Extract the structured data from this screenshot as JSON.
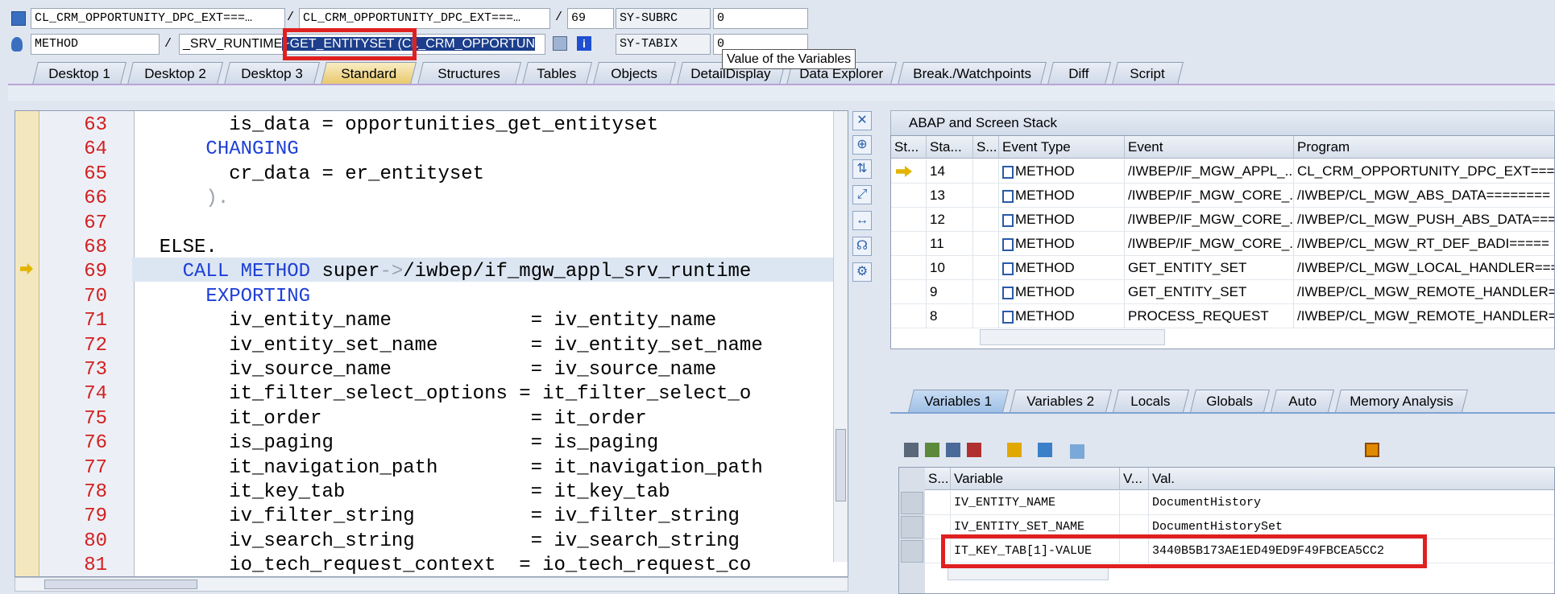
{
  "header": {
    "program_field": "CL_CRM_OPPORTUNITY_DPC_EXT===…",
    "include_field": "CL_CRM_OPPORTUNITY_DPC_EXT===…",
    "line_field": "69",
    "sy_subrc_label": "SY-SUBRC",
    "sy_subrc_value": "0",
    "event_type_field": "METHOD",
    "event_prefix": "_SRV_RUNTIME",
    "event_highlight": "~GET_ENTITYSET (CL_CRM_OPPORTUN",
    "sy_tabix_label": "SY-TABIX",
    "sy_tabix_value": "0",
    "slash1": "/",
    "slash2": "/",
    "slash3": "/",
    "tooltip": "Value of the Variables"
  },
  "tabs": [
    "Desktop 1",
    "Desktop 2",
    "Desktop 3",
    "Standard",
    "Structures",
    "Tables",
    "Objects",
    "DetailDisplay",
    "Data Explorer",
    "Break./Watchpoints",
    "Diff",
    "Script"
  ],
  "code": [
    {
      "n": "63",
      "parts": [
        [
          "",
          "        is_data = opportunities_get_entityset"
        ]
      ]
    },
    {
      "n": "64",
      "parts": [
        [
          "kw",
          "      CHANGING"
        ]
      ]
    },
    {
      "n": "65",
      "parts": [
        [
          "",
          "        cr_data = er_entityset"
        ]
      ]
    },
    {
      "n": "66",
      "parts": [
        [
          "gray",
          "      )."
        ]
      ]
    },
    {
      "n": "67",
      "parts": [
        [
          "",
          ""
        ]
      ]
    },
    {
      "n": "68",
      "parts": [
        [
          "",
          "  ELSE."
        ]
      ]
    },
    {
      "n": "69",
      "parts": [
        [
          "kw",
          "    CALL METHOD "
        ],
        [
          "",
          "super"
        ],
        [
          "gray",
          "->"
        ],
        [
          "",
          "/iwbep/if_mgw_appl_srv_runtime"
        ]
      ]
    },
    {
      "n": "70",
      "parts": [
        [
          "kw",
          "      EXPORTING"
        ]
      ]
    },
    {
      "n": "71",
      "parts": [
        [
          "",
          "        iv_entity_name            = iv_entity_name"
        ]
      ]
    },
    {
      "n": "72",
      "parts": [
        [
          "",
          "        iv_entity_set_name        = iv_entity_set_name"
        ]
      ]
    },
    {
      "n": "73",
      "parts": [
        [
          "",
          "        iv_source_name            = iv_source_name"
        ]
      ]
    },
    {
      "n": "74",
      "parts": [
        [
          "",
          "        it_filter_select_options = it_filter_select_o"
        ]
      ]
    },
    {
      "n": "75",
      "parts": [
        [
          "",
          "        it_order                  = it_order"
        ]
      ]
    },
    {
      "n": "76",
      "parts": [
        [
          "",
          "        is_paging                 = is_paging"
        ]
      ]
    },
    {
      "n": "77",
      "parts": [
        [
          "",
          "        it_navigation_path        = it_navigation_path"
        ]
      ]
    },
    {
      "n": "78",
      "parts": [
        [
          "",
          "        it_key_tab                = it_key_tab"
        ]
      ]
    },
    {
      "n": "79",
      "parts": [
        [
          "",
          "        iv_filter_string          = iv_filter_string"
        ]
      ]
    },
    {
      "n": "80",
      "parts": [
        [
          "",
          "        iv_search_string          = iv_search_string"
        ]
      ]
    },
    {
      "n": "81",
      "parts": [
        [
          "",
          "        io_tech_request_context  = io_tech_request_co"
        ]
      ]
    }
  ],
  "stack": {
    "title": "ABAP and Screen Stack",
    "columns": [
      "St...",
      "Sta...",
      "S...",
      "Event Type",
      "Event",
      "Program"
    ],
    "rows": [
      {
        "level": "14",
        "type": "METHOD",
        "event": "/IWBEP/IF_MGW_APPL_...",
        "program": "CL_CRM_OPPORTUNITY_DPC_EXT======"
      },
      {
        "level": "13",
        "type": "METHOD",
        "event": "/IWBEP/IF_MGW_CORE_...",
        "program": "/IWBEP/CL_MGW_ABS_DATA========"
      },
      {
        "level": "12",
        "type": "METHOD",
        "event": "/IWBEP/IF_MGW_CORE_...",
        "program": "/IWBEP/CL_MGW_PUSH_ABS_DATA==="
      },
      {
        "level": "11",
        "type": "METHOD",
        "event": "/IWBEP/IF_MGW_CORE_...",
        "program": "/IWBEP/CL_MGW_RT_DEF_BADI====="
      },
      {
        "level": "10",
        "type": "METHOD",
        "event": "GET_ENTITY_SET",
        "program": "/IWBEP/CL_MGW_LOCAL_HANDLER==="
      },
      {
        "level": "9",
        "type": "METHOD",
        "event": "GET_ENTITY_SET",
        "program": "/IWBEP/CL_MGW_REMOTE_HANDLER=="
      },
      {
        "level": "8",
        "type": "METHOD",
        "event": "PROCESS_REQUEST",
        "program": "/IWBEP/CL_MGW_REMOTE_HANDLER=="
      }
    ]
  },
  "var_tabs": [
    "Variables 1",
    "Variables 2",
    "Locals",
    "Globals",
    "Auto",
    "Memory Analysis"
  ],
  "variables": {
    "columns": [
      "S...",
      "Variable",
      "V...",
      "Val."
    ],
    "rows": [
      {
        "name": "IV_ENTITY_NAME",
        "value": "DocumentHistory"
      },
      {
        "name": "IV_ENTITY_SET_NAME",
        "value": "DocumentHistorySet"
      },
      {
        "name": "IT_KEY_TAB[1]-VALUE",
        "value": "3440B5B173AE1ED49ED9F49FBCEA5CC2"
      }
    ]
  }
}
